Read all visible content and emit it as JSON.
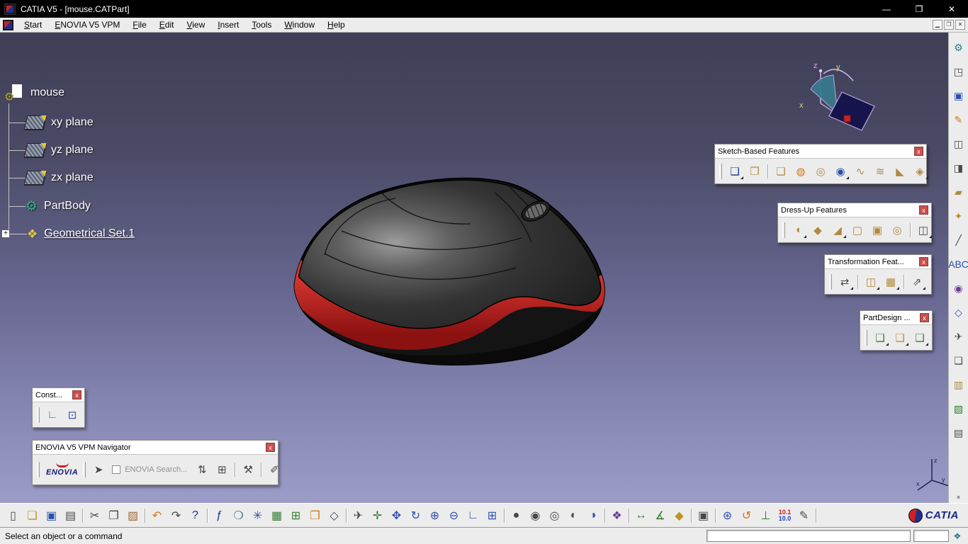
{
  "window": {
    "title": "CATIA V5 - [mouse.CATPart]",
    "minimize": "—",
    "restore": "❐",
    "close": "✕"
  },
  "menubar": {
    "items": [
      {
        "label": "Start"
      },
      {
        "label": "ENOVIA V5 VPM"
      },
      {
        "label": "File"
      },
      {
        "label": "Edit"
      },
      {
        "label": "View"
      },
      {
        "label": "Insert"
      },
      {
        "label": "Tools"
      },
      {
        "label": "Window"
      },
      {
        "label": "Help"
      }
    ],
    "win_controls": {
      "minimize": "▁",
      "restore": "❐",
      "close": "✕"
    }
  },
  "tree": {
    "root": "mouse",
    "items": [
      {
        "label": "xy plane"
      },
      {
        "label": "yz plane"
      },
      {
        "label": "zx plane"
      },
      {
        "label": "PartBody"
      },
      {
        "label": "Geometrical Set.1"
      }
    ],
    "icons": {
      "root": "⚙",
      "partbody": "⚙",
      "geoset": "❖"
    },
    "expander": "+"
  },
  "compass": {
    "x": "x",
    "y": "y",
    "z": "z"
  },
  "toolbars": {
    "sketch": {
      "title": "Sketch-Based Features",
      "close": "x",
      "icons": [
        {
          "name": "pad",
          "glyph": "❑"
        },
        {
          "name": "drafted-filleted-pad",
          "glyph": "❒"
        },
        {
          "name": "pocket",
          "glyph": "❏"
        },
        {
          "name": "shaft",
          "glyph": "◍"
        },
        {
          "name": "groove",
          "glyph": "◎"
        },
        {
          "name": "hole",
          "glyph": "◉"
        },
        {
          "name": "rib",
          "glyph": "∿"
        },
        {
          "name": "slot",
          "glyph": "≋"
        },
        {
          "name": "stiffener",
          "glyph": "◣"
        },
        {
          "name": "multi-sections-solid",
          "glyph": "◈"
        }
      ]
    },
    "dressup": {
      "title": "Dress-Up Features",
      "close": "x",
      "icons": [
        {
          "name": "edge-fillet",
          "glyph": "◖"
        },
        {
          "name": "chamfer",
          "glyph": "◆"
        },
        {
          "name": "draft-angle",
          "glyph": "◢"
        },
        {
          "name": "shell",
          "glyph": "▢"
        },
        {
          "name": "thickness",
          "glyph": "▣"
        },
        {
          "name": "thread-tap",
          "glyph": "◎"
        },
        {
          "name": "remove-face",
          "glyph": "◫"
        }
      ]
    },
    "transform": {
      "title": "Transformation Feat...",
      "close": "x",
      "icons": [
        {
          "name": "translation",
          "glyph": "⇄"
        },
        {
          "name": "mirror",
          "glyph": "◫"
        },
        {
          "name": "rectangular-pattern",
          "glyph": "▦"
        },
        {
          "name": "scaling",
          "glyph": "⇗"
        }
      ]
    },
    "partdesign": {
      "title": "PartDesign ...",
      "close": "x",
      "icons": [
        {
          "name": "assemble",
          "glyph": "❑"
        },
        {
          "name": "boolean-add",
          "glyph": "❑"
        },
        {
          "name": "boolean-remove",
          "glyph": "❑"
        }
      ]
    },
    "constraints": {
      "title": "Const...",
      "close": "x",
      "icons": [
        {
          "name": "constraint",
          "glyph": "∟"
        },
        {
          "name": "constraints-dialog",
          "glyph": "⊡"
        }
      ]
    },
    "enovia": {
      "title": "ENOVIA V5 VPM Navigator",
      "close": "x",
      "logo": "ENOVIA",
      "connect": {
        "name": "enovia-connect",
        "glyph": "➤"
      },
      "search_label": "ENOVIA Search...",
      "icons": [
        {
          "name": "vpm-attributes",
          "glyph": "⇅"
        },
        {
          "name": "vpm-expand",
          "glyph": "⊞"
        }
      ],
      "actions": [
        {
          "name": "vpm-save",
          "glyph": "⚒"
        },
        {
          "name": "vpm-clean",
          "glyph": "✐"
        }
      ]
    }
  },
  "right_toolbar": {
    "overflow": "×",
    "icons": [
      {
        "name": "update",
        "glyph": "⚙"
      },
      {
        "name": "exit-workbench",
        "glyph": "◳"
      },
      {
        "name": "paste-special",
        "glyph": "▣"
      },
      {
        "name": "sketcher",
        "glyph": "✎"
      },
      {
        "name": "multi-pad",
        "glyph": "◫"
      },
      {
        "name": "surfaces",
        "glyph": "◨"
      },
      {
        "name": "reference-plane",
        "glyph": "▰"
      },
      {
        "name": "reference-point",
        "glyph": "✦"
      },
      {
        "name": "reference-line",
        "glyph": "╱"
      },
      {
        "name": "annotations",
        "glyph": "ABC"
      },
      {
        "name": "apply-material",
        "glyph": "◉"
      },
      {
        "name": "analysis",
        "glyph": "◇"
      },
      {
        "name": "fly",
        "glyph": "✈"
      },
      {
        "name": "catalog",
        "glyph": "❏"
      },
      {
        "name": "grid",
        "glyph": "▥"
      },
      {
        "name": "measure",
        "glyph": "▧"
      },
      {
        "name": "knowledge",
        "glyph": "▤"
      }
    ]
  },
  "bottom_toolbar": {
    "file": [
      {
        "name": "new-document",
        "glyph": "▯"
      },
      {
        "name": "open-folder",
        "glyph": "❏"
      },
      {
        "name": "save",
        "glyph": "▣"
      },
      {
        "name": "print",
        "glyph": "▤"
      }
    ],
    "clipboard": [
      {
        "name": "cut",
        "glyph": "✂"
      },
      {
        "name": "copy",
        "glyph": "❐"
      },
      {
        "name": "paste",
        "glyph": "▨"
      }
    ],
    "history": [
      {
        "name": "undo",
        "glyph": "↶"
      },
      {
        "name": "redo",
        "glyph": "↷"
      },
      {
        "name": "whats-this-help",
        "glyph": "?"
      }
    ],
    "knowledge": [
      {
        "name": "formula",
        "glyph": "ƒ"
      },
      {
        "name": "comment",
        "glyph": "❍"
      },
      {
        "name": "knowledge-inspector",
        "glyph": "✳"
      },
      {
        "name": "design-table",
        "glyph": "▦"
      },
      {
        "name": "table-edit",
        "glyph": "⊞"
      },
      {
        "name": "catalog-browser",
        "glyph": "❒"
      },
      {
        "name": "library",
        "glyph": "◇"
      }
    ],
    "view": [
      {
        "name": "fly-mode",
        "glyph": "✈"
      },
      {
        "name": "fit-all-in",
        "glyph": "✛"
      },
      {
        "name": "pan",
        "glyph": "✥"
      },
      {
        "name": "rotate",
        "glyph": "↻"
      },
      {
        "name": "zoom-in",
        "glyph": "⊕"
      },
      {
        "name": "zoom-out",
        "glyph": "⊖"
      },
      {
        "name": "normal-view",
        "glyph": "∟"
      },
      {
        "name": "multi-view",
        "glyph": "⊞"
      }
    ],
    "render": [
      {
        "name": "shading",
        "glyph": "●"
      },
      {
        "name": "shading-with-edges",
        "glyph": "◉"
      },
      {
        "name": "wireframe",
        "glyph": "◎"
      },
      {
        "name": "render-style",
        "glyph": "◐"
      },
      {
        "name": "hide-show",
        "glyph": "◑"
      }
    ],
    "visibility": [
      {
        "name": "swap-visible-space",
        "glyph": "❖"
      }
    ],
    "measure": [
      {
        "name": "measure-between",
        "glyph": "↔"
      },
      {
        "name": "measure-item",
        "glyph": "∡"
      },
      {
        "name": "mass-properties",
        "glyph": "◆"
      }
    ],
    "capture": [
      {
        "name": "capture-camera",
        "glyph": "▣"
      }
    ],
    "tools": [
      {
        "name": "publish-web",
        "glyph": "⊛"
      },
      {
        "name": "session-replay",
        "glyph": "↺"
      },
      {
        "name": "axis-system",
        "glyph": "⊥"
      }
    ],
    "version": {
      "top": "10.1",
      "bottom": "10.0"
    },
    "tools2": [
      {
        "name": "annotate",
        "glyph": "✎"
      }
    ],
    "brand": "CATIA"
  },
  "statusbar": {
    "message": "Select an object or a command"
  }
}
